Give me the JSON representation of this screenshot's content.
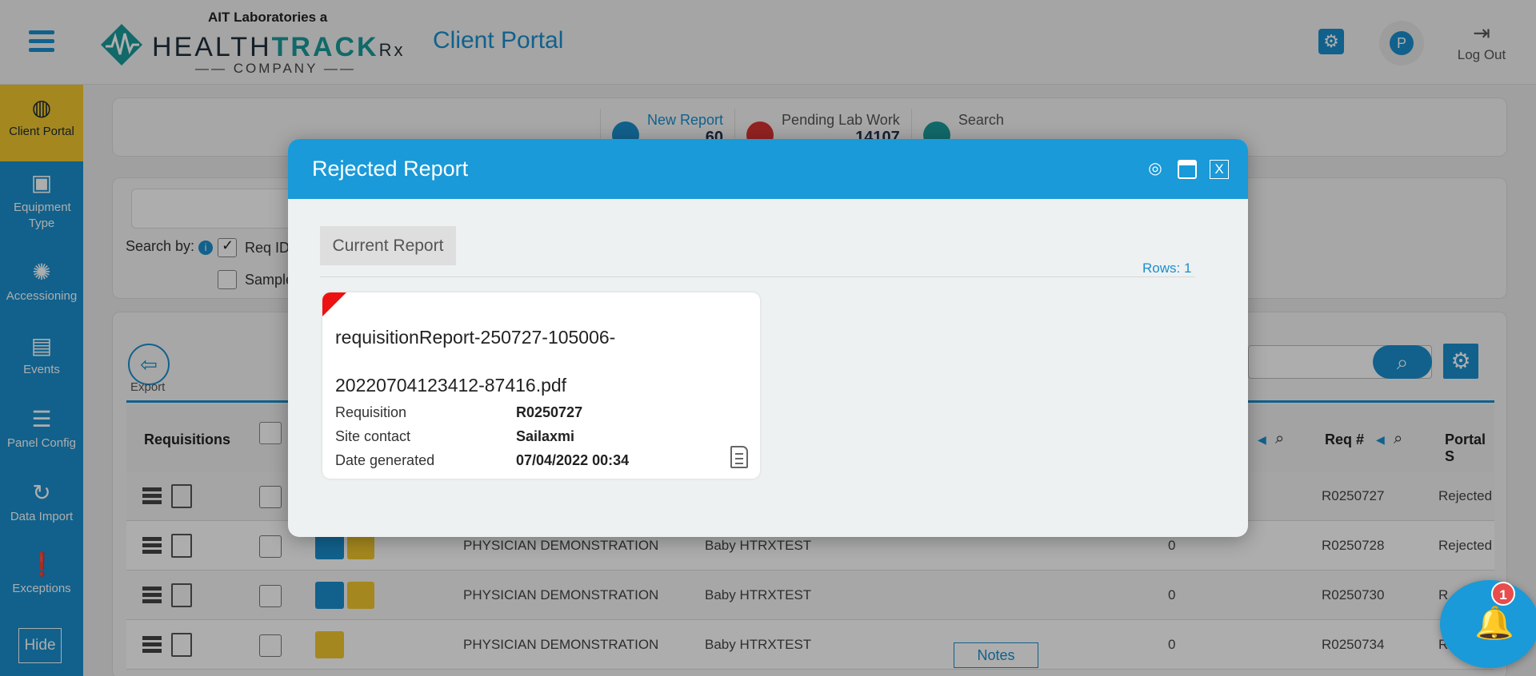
{
  "header": {
    "logo_top": "AIT Laboratories a",
    "logo_health": "HEALTH",
    "logo_track": "TRACK",
    "logo_rx": "Rx",
    "logo_bottom": "COMPANY",
    "portal_title": "Client Portal",
    "avatar_initial": "P",
    "logout_label": "Log Out"
  },
  "sidebar": {
    "items": [
      {
        "label": "Client Portal",
        "icon": "globe-icon"
      },
      {
        "label": "Equipment Type",
        "icon": "monitor-icon"
      },
      {
        "label": "Accessioning",
        "icon": "spinner-icon"
      },
      {
        "label": "Events",
        "icon": "list-icon"
      },
      {
        "label": "Panel Config",
        "icon": "checklist-icon"
      },
      {
        "label": "Data Import",
        "icon": "import-icon"
      },
      {
        "label": "Exceptions",
        "icon": "exclamation-icon"
      }
    ],
    "hide_label": "Hide"
  },
  "stats": {
    "new_report_label": "New Report",
    "new_report_count": "60",
    "pending_label": "Pending Lab Work",
    "pending_count": "14107",
    "search_label": "Search"
  },
  "filters": {
    "search_by_label": "Search by:",
    "req_id_label": "Req ID",
    "sample_label": "Sample"
  },
  "toolbar": {
    "export_label": "Export"
  },
  "table": {
    "headers": {
      "requisitions": "Requisitions",
      "req_no": "Req #",
      "portal_status": "Portal S"
    },
    "rows": [
      {
        "org": "",
        "patient": "",
        "count": "",
        "req": "R0250727",
        "status": "Rejected"
      },
      {
        "org": "PHYSICIAN DEMONSTRATION",
        "patient": "Baby HTRXTEST",
        "count": "0",
        "req": "R0250728",
        "status": "Rejected"
      },
      {
        "org": "PHYSICIAN DEMONSTRATION",
        "patient": "Baby HTRXTEST",
        "count": "0",
        "req": "R0250730",
        "status": "R"
      },
      {
        "org": "PHYSICIAN DEMONSTRATION",
        "patient": "Baby HTRXTEST",
        "count": "0",
        "req": "R0250734",
        "status": "Rejected"
      }
    ],
    "notes_label": "Notes"
  },
  "modal": {
    "title": "Rejected Report",
    "close_label": "X",
    "tab_label": "Current Report",
    "rows_label": "Rows: 1",
    "card": {
      "title_line1": "requisitionReport-250727-105006-",
      "title_line2": "20220704123412-87416.pdf",
      "requisition_label": "Requisition",
      "requisition_value": "R0250727",
      "site_contact_label": "Site contact",
      "site_contact_value": "Sailaxmi",
      "date_label": "Date generated",
      "date_value": "07/04/2022 00:34"
    }
  },
  "notifications": {
    "count": "1"
  },
  "colors": {
    "primary": "#1a8fcf",
    "modal_header": "#1a9ad8",
    "active_nav": "#f2c72d",
    "rejected_flag": "#ee1111"
  }
}
